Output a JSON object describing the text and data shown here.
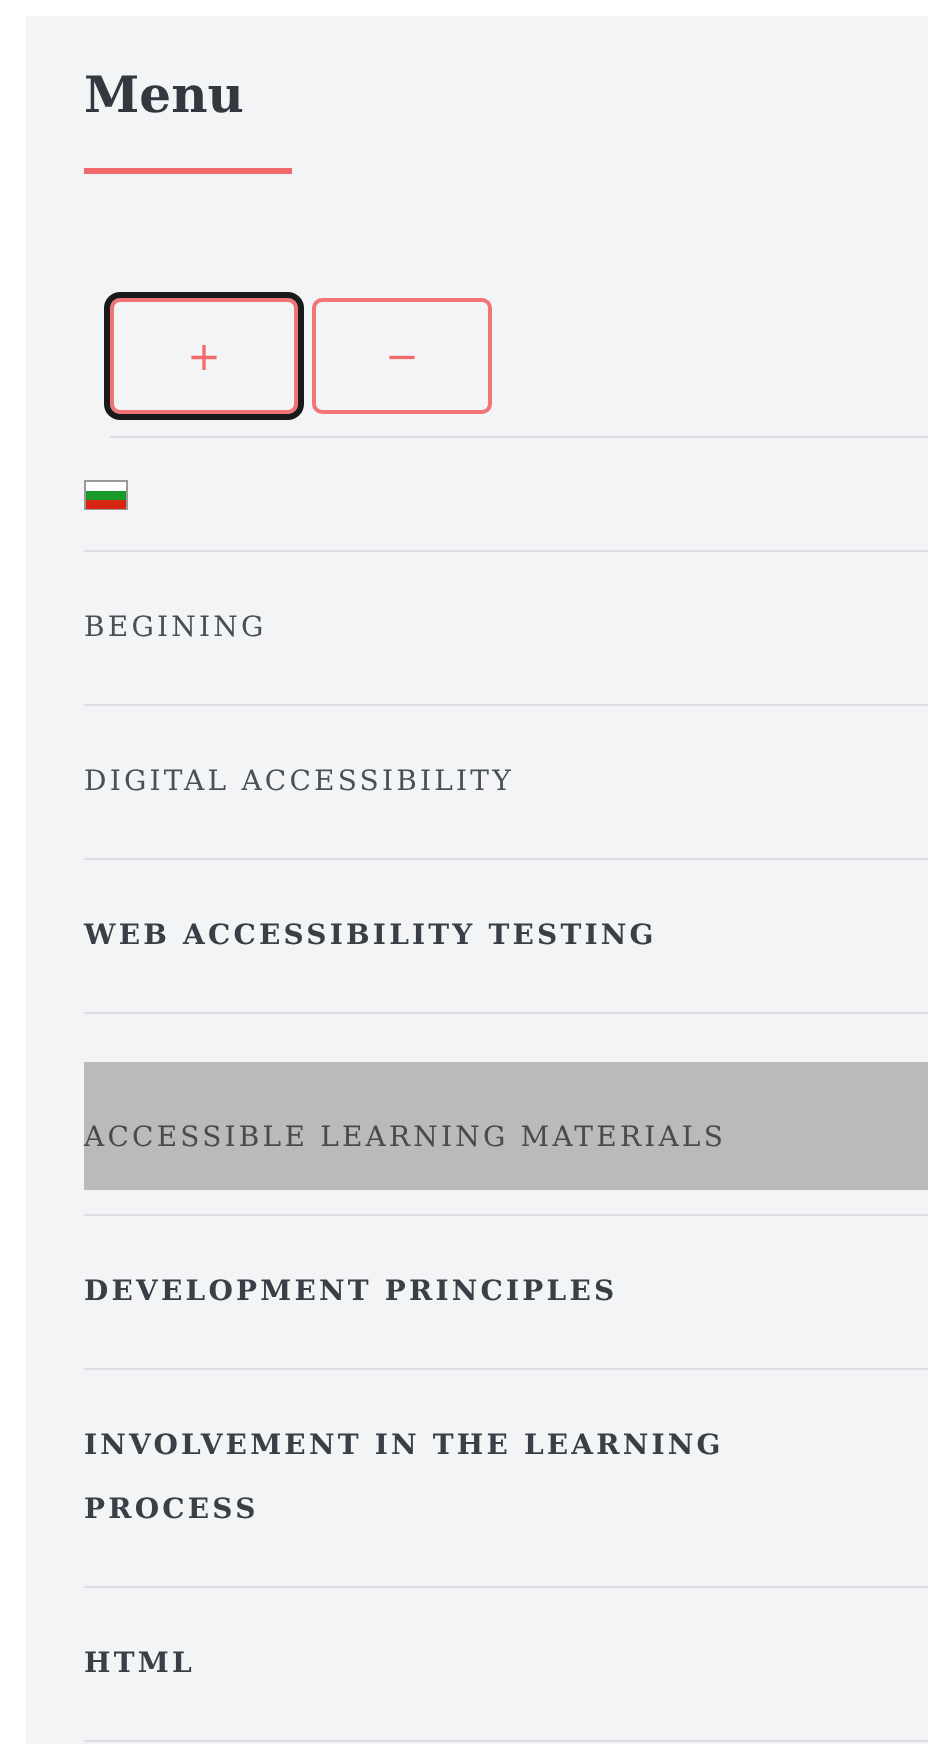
{
  "title": "Menu",
  "font_buttons": [
    {
      "label": "+",
      "focused": true
    },
    {
      "label": "−",
      "focused": false
    }
  ],
  "language": {
    "kind": "flag"
  },
  "items": [
    {
      "label": "BEGINING",
      "bold": false,
      "selected": false
    },
    {
      "label": "DIGITAL ACCESSIBILITY",
      "bold": false,
      "selected": false
    },
    {
      "label": "WEB ACCESSIBILITY TESTING",
      "bold": true,
      "selected": false
    },
    {
      "label": "ACCESSIBLE LEARNING MATERIALS",
      "bold": false,
      "selected": true
    },
    {
      "label": "DEVELOPMENT PRINCIPLES",
      "bold": true,
      "selected": false
    },
    {
      "label": "INVOLVEMENT IN THE LEARNING PROCESS",
      "bold": true,
      "selected": false
    },
    {
      "label": "HTML",
      "bold": true,
      "selected": false
    }
  ]
}
